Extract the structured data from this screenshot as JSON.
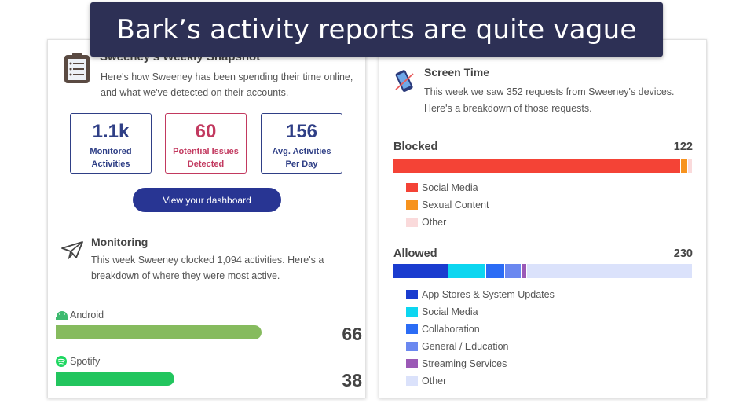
{
  "banner": {
    "text": "Bark’s activity reports are quite vague"
  },
  "snapshot": {
    "title": "Sweeney's Weekly Snapshot",
    "description": "Here's how Sweeney has been spending their time online, and what we've detected on their accounts.",
    "stats": [
      {
        "value": "1.1k",
        "label_line1": "Monitored",
        "label_line2": "Activities",
        "color": "#2f3f86"
      },
      {
        "value": "60",
        "label_line1": "Potential Issues",
        "label_line2": "Detected",
        "color": "#c2395f"
      },
      {
        "value": "156",
        "label_line1": "Avg. Activities",
        "label_line2": "Per Day",
        "color": "#2f3f86"
      }
    ],
    "dashboard_button": "View your dashboard"
  },
  "monitoring": {
    "title": "Monitoring",
    "description": "This week Sweeney clocked 1,094 activities. Here's a breakdown of where they were most active.",
    "apps": [
      {
        "name": "Android",
        "count": "66",
        "value": 66,
        "color": "#86bb5e",
        "icon": "android-icon"
      },
      {
        "name": "Spotify",
        "count": "38",
        "value": 38,
        "color": "#22c55e",
        "icon": "spotify-icon"
      }
    ]
  },
  "screen_time": {
    "title": "Screen Time",
    "description": "This week we saw 352 requests from Sweeney's devices. Here's a breakdown of those requests.",
    "blocked": {
      "label": "Blocked",
      "total": "122",
      "segments": [
        {
          "name": "Social Media",
          "share": 0.965,
          "color": "#f44336"
        },
        {
          "name": "Sexual Content",
          "share": 0.022,
          "color": "#f7931e"
        },
        {
          "name": "Other",
          "share": 0.013,
          "color": "#fadadb"
        }
      ]
    },
    "allowed": {
      "label": "Allowed",
      "total": "230",
      "segments": [
        {
          "name": "App Stores & System Updates",
          "share": 0.183,
          "color": "#1a3ccf"
        },
        {
          "name": "Social Media",
          "share": 0.125,
          "color": "#0dd6f0"
        },
        {
          "name": "Collaboration",
          "share": 0.062,
          "color": "#2b6cf5"
        },
        {
          "name": "General / Education",
          "share": 0.055,
          "color": "#6b88f0"
        },
        {
          "name": "Streaming Services",
          "share": 0.015,
          "color": "#9b59b6"
        },
        {
          "name": "Other",
          "share": 0.56,
          "color": "#dbe2fb"
        }
      ]
    }
  }
}
